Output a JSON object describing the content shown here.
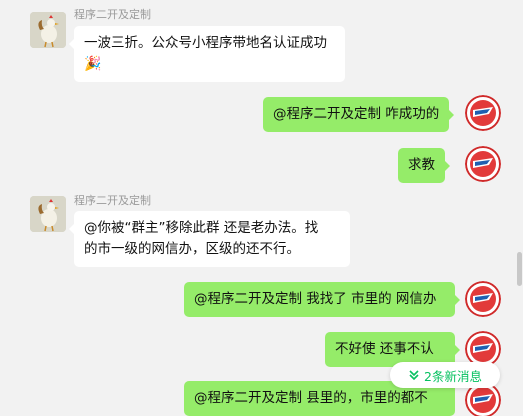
{
  "messages": [
    {
      "side": "left",
      "sender": "程序二开及定制",
      "lines": [
        "一波三折。公众号小程序带地名认证成功",
        "🎉"
      ]
    },
    {
      "side": "right",
      "text": "@程序二开及定制 咋成功的"
    },
    {
      "side": "right",
      "text": "求教"
    },
    {
      "side": "left",
      "sender": "程序二开及定制",
      "lines": [
        "@你被“群主”移除此群 还是老办法。找",
        "的市一级的网信办，区级的还不行。"
      ]
    },
    {
      "side": "right",
      "text": "@程序二开及定制 我找了 市里的 网信办"
    },
    {
      "side": "right",
      "text": "不好使 还事不认"
    },
    {
      "side": "right",
      "text": "@程序二开及定制  县里的，市里的都不"
    }
  ],
  "new_messages": {
    "label": "2条新消息",
    "icon": "double-chevron-down-icon"
  },
  "colors": {
    "background": "#f2f2f2",
    "self_bubble": "#95ec69",
    "other_bubble": "#ffffff",
    "accent": "#07c160"
  }
}
